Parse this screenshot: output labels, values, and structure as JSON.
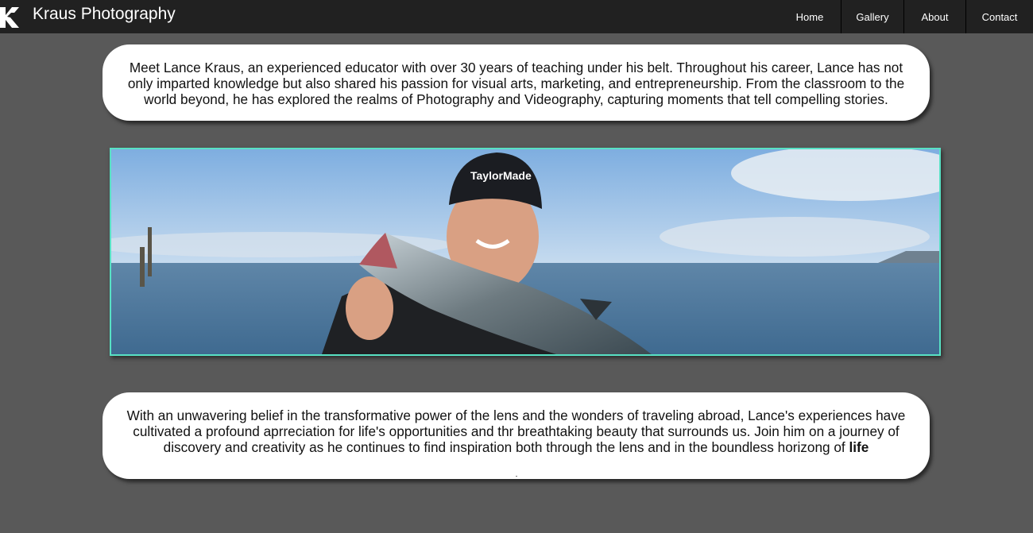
{
  "brand": {
    "name": "Kraus Photography",
    "logo": "K-logo-icon"
  },
  "nav": {
    "home": "Home",
    "gallery": "Gallery",
    "about": "About",
    "contact": "Contact"
  },
  "intro": {
    "text": "Meet Lance Kraus, an experienced educator with over 30 years of teaching under his belt. Throughout his career, Lance has not only imparted knowledge but also shared his passion for visual arts, marketing, and entrepreneurship. From the classroom to the world beyond, he has explored the realms of Photography and Videography, capturing moments that tell compelling stories."
  },
  "outro": {
    "text": "With an unwavering belief in the transformative power of the lens and the wonders of traveling abroad, Lance's experiences have cultivated a profound aprreciation for life's opportunities and thr breathtaking beauty that surrounds us. Join him on a journey of discovery and creativity as he continues to find inspiration both through the lens and in the boundless horizong of",
    "emphasis": "life"
  },
  "colors": {
    "page_bg": "#595959",
    "nav_bg": "#212121",
    "photo_border": "#58e1c4",
    "card_bg": "#ffffff"
  }
}
